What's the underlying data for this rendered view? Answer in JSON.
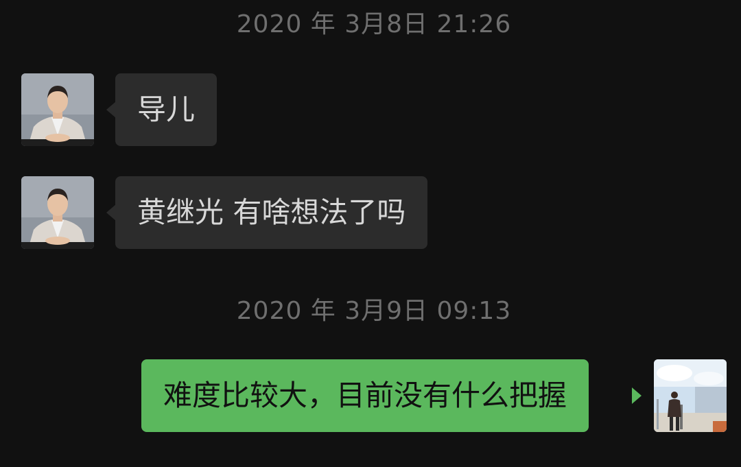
{
  "colors": {
    "background": "#111111",
    "timestamp_text": "#6f6f6f",
    "incoming_bubble": "#2c2c2c",
    "incoming_text": "#d8d8d8",
    "outgoing_bubble": "#5bb85d",
    "outgoing_text": "#111111"
  },
  "chat": {
    "timestamp_1": "2020 年 3月8日 21:26",
    "msg_1": "导儿",
    "msg_2": "黄继光 有啥想法了吗",
    "timestamp_2": "2020 年 3月9日 09:13",
    "msg_3": "难度比较大，目前没有什么把握"
  },
  "avatars": {
    "contact": "person-in-suit-photo",
    "self": "person-on-street-photo"
  }
}
